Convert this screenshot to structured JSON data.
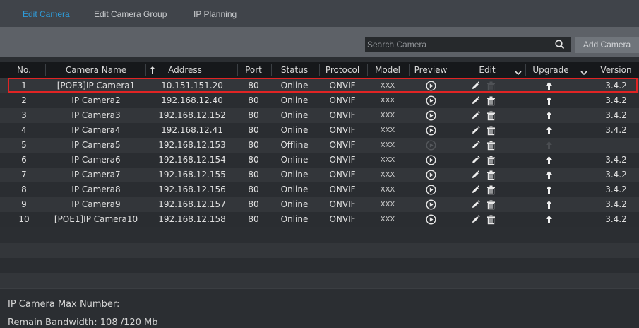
{
  "tabs": [
    {
      "label": "Edit Camera",
      "active": true
    },
    {
      "label": "Edit Camera Group",
      "active": false
    },
    {
      "label": "IP Planning",
      "active": false
    }
  ],
  "toolbar": {
    "search_placeholder": "Search Camera",
    "add_label": "Add Camera"
  },
  "table": {
    "columns": [
      "No.",
      "Camera Name",
      "Address",
      "Port",
      "Status",
      "Protocol",
      "Model",
      "Preview",
      "Edit",
      "Upgrade",
      "Version"
    ],
    "rows": [
      {
        "no": "1",
        "name": "[POE3]IP Camera1",
        "address": "10.151.151.20",
        "port": "80",
        "status": "Online",
        "protocol": "ONVIF",
        "model": "XXX",
        "version": "3.4.2",
        "selected": true
      },
      {
        "no": "2",
        "name": "IP Camera2",
        "address": "192.168.12.40",
        "port": "80",
        "status": "Online",
        "protocol": "ONVIF",
        "model": "XXX",
        "version": "3.4.2"
      },
      {
        "no": "3",
        "name": "IP Camera3",
        "address": "192.168.12.152",
        "port": "80",
        "status": "Online",
        "protocol": "ONVIF",
        "model": "XXX",
        "version": "3.4.2"
      },
      {
        "no": "4",
        "name": "IP Camera4",
        "address": "192.168.12.41",
        "port": "80",
        "status": "Online",
        "protocol": "ONVIF",
        "model": "XXX",
        "version": "3.4.2"
      },
      {
        "no": "5",
        "name": "IP Camera5",
        "address": "192.168.12.153",
        "port": "80",
        "status": "Offline",
        "protocol": "ONVIF",
        "model": "XXX",
        "version": ""
      },
      {
        "no": "6",
        "name": "IP Camera6",
        "address": "192.168.12.154",
        "port": "80",
        "status": "Online",
        "protocol": "ONVIF",
        "model": "XXX",
        "version": "3.4.2"
      },
      {
        "no": "7",
        "name": "IP Camera7",
        "address": "192.168.12.155",
        "port": "80",
        "status": "Online",
        "protocol": "ONVIF",
        "model": "XXX",
        "version": "3.4.2"
      },
      {
        "no": "8",
        "name": "IP Camera8",
        "address": "192.168.12.156",
        "port": "80",
        "status": "Online",
        "protocol": "ONVIF",
        "model": "XXX",
        "version": "3.4.2"
      },
      {
        "no": "9",
        "name": "IP Camera9",
        "address": "192.168.12.157",
        "port": "80",
        "status": "Online",
        "protocol": "ONVIF",
        "model": "XXX",
        "version": "3.4.2"
      },
      {
        "no": "10",
        "name": "[POE1]IP Camera10",
        "address": "192.168.12.158",
        "port": "80",
        "status": "Online",
        "protocol": "ONVIF",
        "model": "XXX",
        "version": "3.4.2"
      }
    ]
  },
  "footer": {
    "max_number_label": "IP Camera Max Number:",
    "bandwidth_label": "Remain Bandwidth: 108 /120 Mb"
  },
  "colors": {
    "accent": "#2f9bd8",
    "selection_border": "#e02424"
  },
  "icons": [
    "search-icon",
    "sort-up-icon",
    "dropdown-arrow-icon",
    "play-icon",
    "pencil-icon",
    "trash-icon",
    "upgrade-arrow-icon"
  ]
}
